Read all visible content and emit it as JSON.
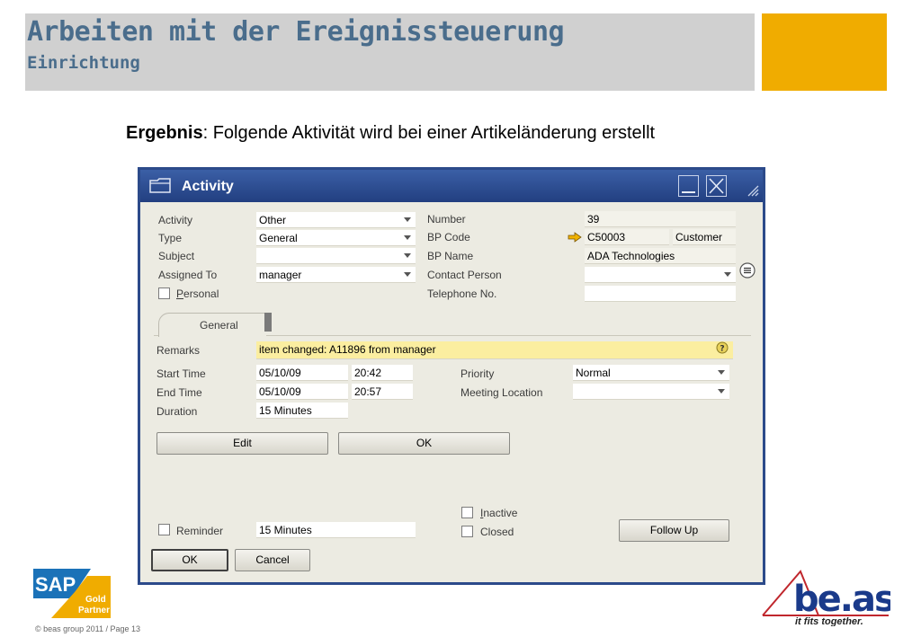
{
  "slide": {
    "title": "Arbeiten mit der Ereignissteuerung",
    "subtitle": "Einrichtung",
    "caption_bold": "Ergebnis",
    "caption_rest": ": Folgende Aktivität wird bei einer Artikeländerung erstellt",
    "footer": "© beas group 2011 / Page 13",
    "sap_logo": {
      "brand": "SAP",
      "badge_line1": "Gold",
      "badge_line2": "Partner"
    },
    "beas_logo": {
      "name": "be.as",
      "tagline": "it fits together."
    },
    "colors": {
      "title": "#4a6d8c",
      "accent": "#f0ac00",
      "window_frame": "#2c4a8a"
    }
  },
  "window": {
    "title": "Activity",
    "icons": {
      "window": "form-icon",
      "minimize": "minimize-icon",
      "close": "close-icon"
    }
  },
  "header": {
    "activity_label": "Activity",
    "activity_value": "Other",
    "type_label": "Type",
    "type_value": "General",
    "subject_label": "Subject",
    "subject_value": "",
    "assigned_label": "Assigned To",
    "assigned_value": "manager",
    "personal_label": "Personal",
    "number_label": "Number",
    "number_value": "39",
    "bpcode_label": "BP Code",
    "bpcode_value": "C50003",
    "bpcode_type": "Customer",
    "bpname_label": "BP Name",
    "bpname_value": "ADA Technologies",
    "contact_label": "Contact Person",
    "contact_value": "",
    "phone_label": "Telephone No.",
    "phone_value": ""
  },
  "tabs": [
    {
      "label": "General"
    }
  ],
  "general": {
    "remarks_label": "Remarks",
    "remarks_value": "item changed: A11896 from manager",
    "start_label": "Start Time",
    "start_date": "05/10/09",
    "start_time": "20:42",
    "end_label": "End Time",
    "end_date": "05/10/09",
    "end_time": "20:57",
    "duration_label": "Duration",
    "duration_value": "15 Minutes",
    "priority_label": "Priority",
    "priority_value": "Normal",
    "meeting_label": "Meeting Location",
    "meeting_value": "",
    "edit_button": "Edit",
    "ok_inner_button": "OK",
    "reminder_label": "Reminder",
    "reminder_value": "15 Minutes",
    "inactive_label": "Inactive",
    "closed_label": "Closed",
    "followup_button": "Follow Up"
  },
  "footer_buttons": {
    "ok": "OK",
    "cancel": "Cancel"
  }
}
